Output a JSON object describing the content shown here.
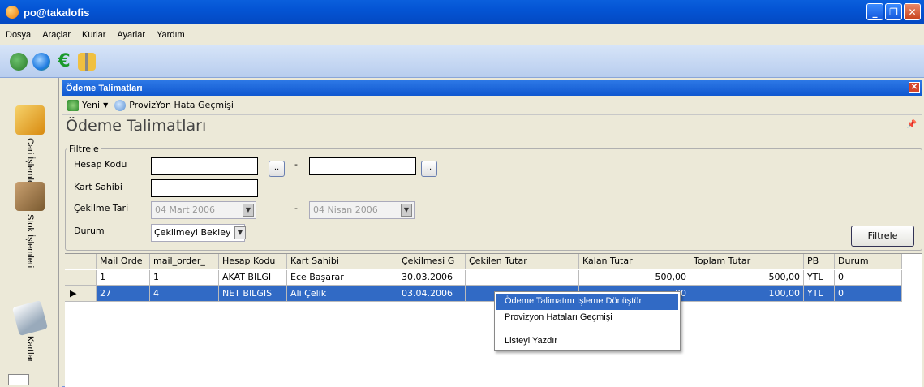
{
  "window": {
    "title": "po@takalofis"
  },
  "menu": [
    "Dosya",
    "Araçlar",
    "Kurlar",
    "Ayarlar",
    "Yardım"
  ],
  "sidebar": [
    {
      "label": "Cari İşlemler",
      "icon": "box-icon"
    },
    {
      "label": "Stok İşlemleri",
      "icon": "hand-truck-icon"
    },
    {
      "label": "Kartlar",
      "icon": "card-icon"
    }
  ],
  "child": {
    "title": "Ödeme Talimatları",
    "new_label": "Yeni",
    "history_label": "ProvizYon Hata Geçmişi",
    "panel_title": "Ödeme Talimatları"
  },
  "filter": {
    "legend": "Filtrele",
    "hesap_kodu_label": "Hesap Kodu",
    "kart_sahibi_label": "Kart Sahibi",
    "cekilme_label": "Çekilme Tari",
    "durum_label": "Durum",
    "dash": "-",
    "dots": "..",
    "date_from": "04  Mart  2006",
    "date_to": "04  Nisan  2006",
    "durum_value": "Çekilmeyi Bekley",
    "button": "Filtrele"
  },
  "grid": {
    "columns": [
      "Mail Orde",
      "mail_order_",
      "Hesap Kodu",
      "Kart Sahibi",
      "Çekilmesi G",
      "Çekilen Tutar",
      "Kalan Tutar",
      "Toplam Tutar",
      "PB",
      "Durum"
    ],
    "rows": [
      [
        "1",
        "1",
        "AKAT BILGI",
        "Ece Başarar",
        "30.03.2006",
        "",
        "500,00",
        "500,00",
        "YTL",
        "0"
      ],
      [
        "27",
        "4",
        "NET BILGIS",
        "Ali Çelik",
        "03.04.2006",
        "",
        "",
        "100,00",
        "YTL",
        "0"
      ]
    ],
    "selected_kalan_partial": "00"
  },
  "context_menu": [
    "Ödeme Talimatını İşleme Dönüştür",
    "Provizyon Hataları Geçmişi",
    "Listeyi Yazdır"
  ]
}
